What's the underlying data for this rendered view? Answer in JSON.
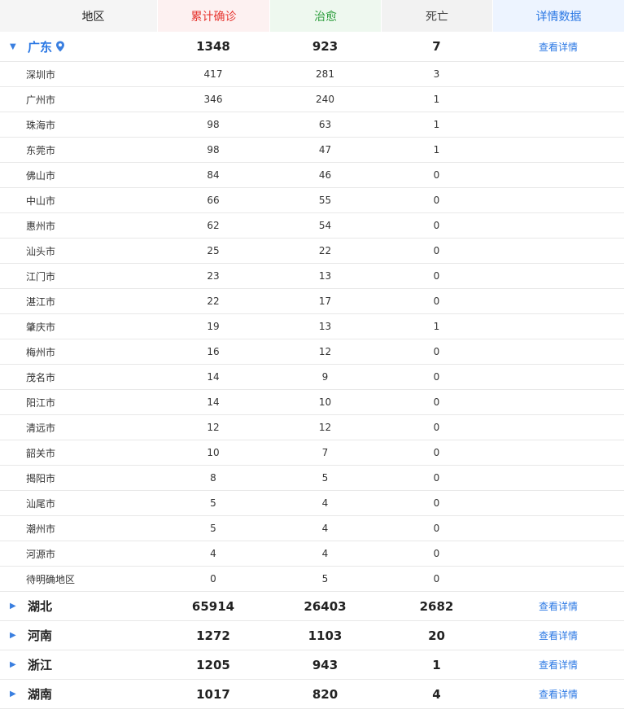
{
  "header": {
    "region": "地区",
    "confirmed": "累计确诊",
    "cured": "治愈",
    "dead": "死亡",
    "detail": "详情数据"
  },
  "expanded_province": {
    "name": "广东",
    "confirmed": "1348",
    "cured": "923",
    "dead": "7",
    "link": "查看详情",
    "arrow_icon": "triangle-down-icon",
    "pin_icon": "location-pin-icon"
  },
  "cities": [
    {
      "name": "深圳市",
      "confirmed": "417",
      "cured": "281",
      "dead": "3"
    },
    {
      "name": "广州市",
      "confirmed": "346",
      "cured": "240",
      "dead": "1"
    },
    {
      "name": "珠海市",
      "confirmed": "98",
      "cured": "63",
      "dead": "1"
    },
    {
      "name": "东莞市",
      "confirmed": "98",
      "cured": "47",
      "dead": "1"
    },
    {
      "name": "佛山市",
      "confirmed": "84",
      "cured": "46",
      "dead": "0"
    },
    {
      "name": "中山市",
      "confirmed": "66",
      "cured": "55",
      "dead": "0"
    },
    {
      "name": "惠州市",
      "confirmed": "62",
      "cured": "54",
      "dead": "0"
    },
    {
      "name": "汕头市",
      "confirmed": "25",
      "cured": "22",
      "dead": "0"
    },
    {
      "name": "江门市",
      "confirmed": "23",
      "cured": "13",
      "dead": "0"
    },
    {
      "name": "湛江市",
      "confirmed": "22",
      "cured": "17",
      "dead": "0"
    },
    {
      "name": "肇庆市",
      "confirmed": "19",
      "cured": "13",
      "dead": "1"
    },
    {
      "name": "梅州市",
      "confirmed": "16",
      "cured": "12",
      "dead": "0"
    },
    {
      "name": "茂名市",
      "confirmed": "14",
      "cured": "9",
      "dead": "0"
    },
    {
      "name": "阳江市",
      "confirmed": "14",
      "cured": "10",
      "dead": "0"
    },
    {
      "name": "清远市",
      "confirmed": "12",
      "cured": "12",
      "dead": "0"
    },
    {
      "name": "韶关市",
      "confirmed": "10",
      "cured": "7",
      "dead": "0"
    },
    {
      "name": "揭阳市",
      "confirmed": "8",
      "cured": "5",
      "dead": "0"
    },
    {
      "name": "汕尾市",
      "confirmed": "5",
      "cured": "4",
      "dead": "0"
    },
    {
      "name": "潮州市",
      "confirmed": "5",
      "cured": "4",
      "dead": "0"
    },
    {
      "name": "河源市",
      "confirmed": "4",
      "cured": "4",
      "dead": "0"
    },
    {
      "name": "待明确地区",
      "confirmed": "0",
      "cured": "5",
      "dead": "0"
    }
  ],
  "provinces": [
    {
      "name": "湖北",
      "confirmed": "65914",
      "cured": "26403",
      "dead": "2682",
      "link": "查看详情"
    },
    {
      "name": "河南",
      "confirmed": "1272",
      "cured": "1103",
      "dead": "20",
      "link": "查看详情"
    },
    {
      "name": "浙江",
      "confirmed": "1205",
      "cured": "943",
      "dead": "1",
      "link": "查看详情"
    },
    {
      "name": "湖南",
      "confirmed": "1017",
      "cured": "820",
      "dead": "4",
      "link": "查看详情"
    }
  ],
  "colors": {
    "confirmed": "#e6352f",
    "cured": "#2e9e3e",
    "detail": "#2b78e4"
  }
}
